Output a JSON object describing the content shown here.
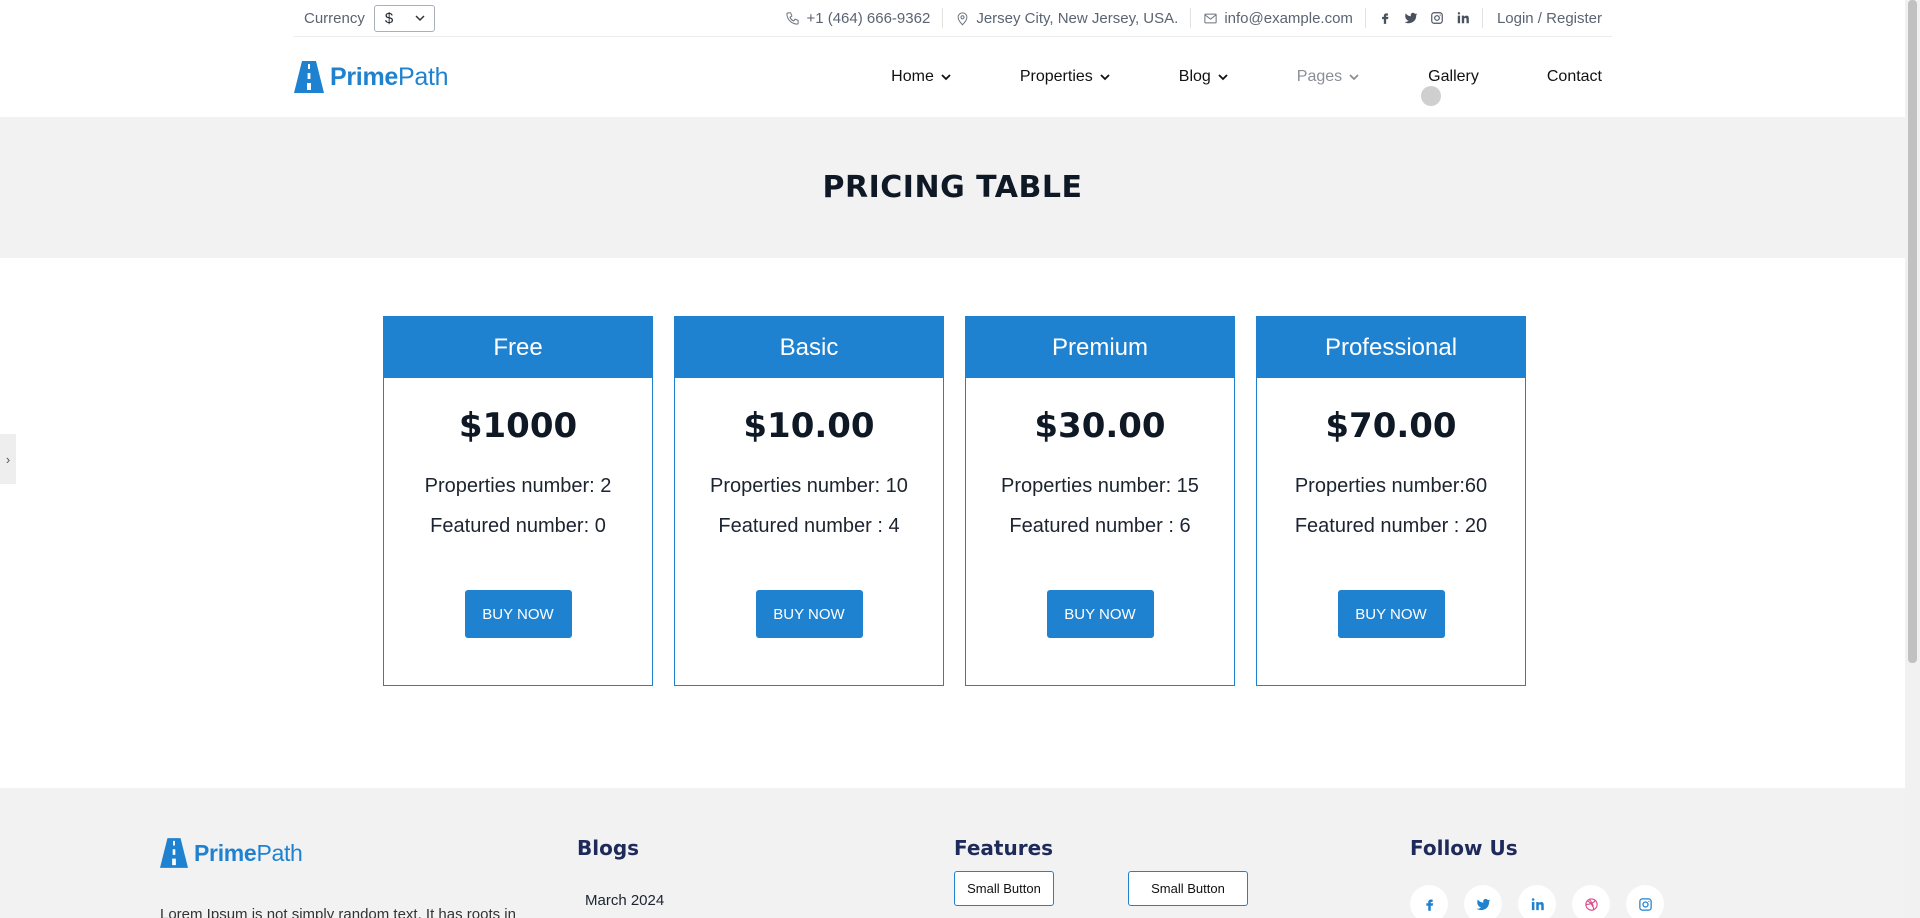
{
  "topbar": {
    "currency_label": "Currency",
    "currency_value": "$",
    "phone": "+1 (464) 666-9362",
    "address": "Jersey City, New Jersey, USA.",
    "email": "info@example.com",
    "login": "Login / Register"
  },
  "brand": {
    "name_bold": "Prime",
    "name_light": "Path",
    "color": "#1f82d0"
  },
  "nav": {
    "home": "Home",
    "properties": "Properties",
    "blog": "Blog",
    "pages": "Pages",
    "gallery": "Gallery",
    "contact": "Contact"
  },
  "banner": {
    "title": "PRICING TABLE"
  },
  "plans": [
    {
      "name": "Free",
      "price": "$1000",
      "properties": "Properties number: 2",
      "featured": "Featured number: 0",
      "button": "BUY NOW"
    },
    {
      "name": "Basic",
      "price": "$10.00",
      "properties": "Properties number: 10",
      "featured": "Featured number : 4",
      "button": "BUY NOW"
    },
    {
      "name": "Premium",
      "price": "$30.00",
      "properties": "Properties number: 15",
      "featured": "Featured number : 6",
      "button": "BUY NOW"
    },
    {
      "name": "Professional",
      "price": "$70.00",
      "properties": "Properties number:60",
      "featured": "Featured number : 20",
      "button": "BUY NOW"
    }
  ],
  "footer": {
    "about_text": "Lorem Ipsum is not simply random text. It has roots in",
    "blogs_heading": "Blogs",
    "blog_link": "March 2024",
    "features_heading": "Features",
    "small_button_1": "Small Button",
    "small_button_2": "Small Button",
    "follow_heading": "Follow Us"
  },
  "icons": {
    "social": [
      "facebook-icon",
      "twitter-icon",
      "instagram-icon",
      "linkedin-icon"
    ],
    "footer_social": [
      "facebook-icon",
      "twitter-icon",
      "linkedin-icon",
      "dribbble-icon",
      "instagram-icon"
    ]
  },
  "colors": {
    "primary": "#1f82d0",
    "heading_dark": "#0f1926",
    "footer_heading": "#1e2a5a",
    "dribbble": "#e04a8a"
  }
}
